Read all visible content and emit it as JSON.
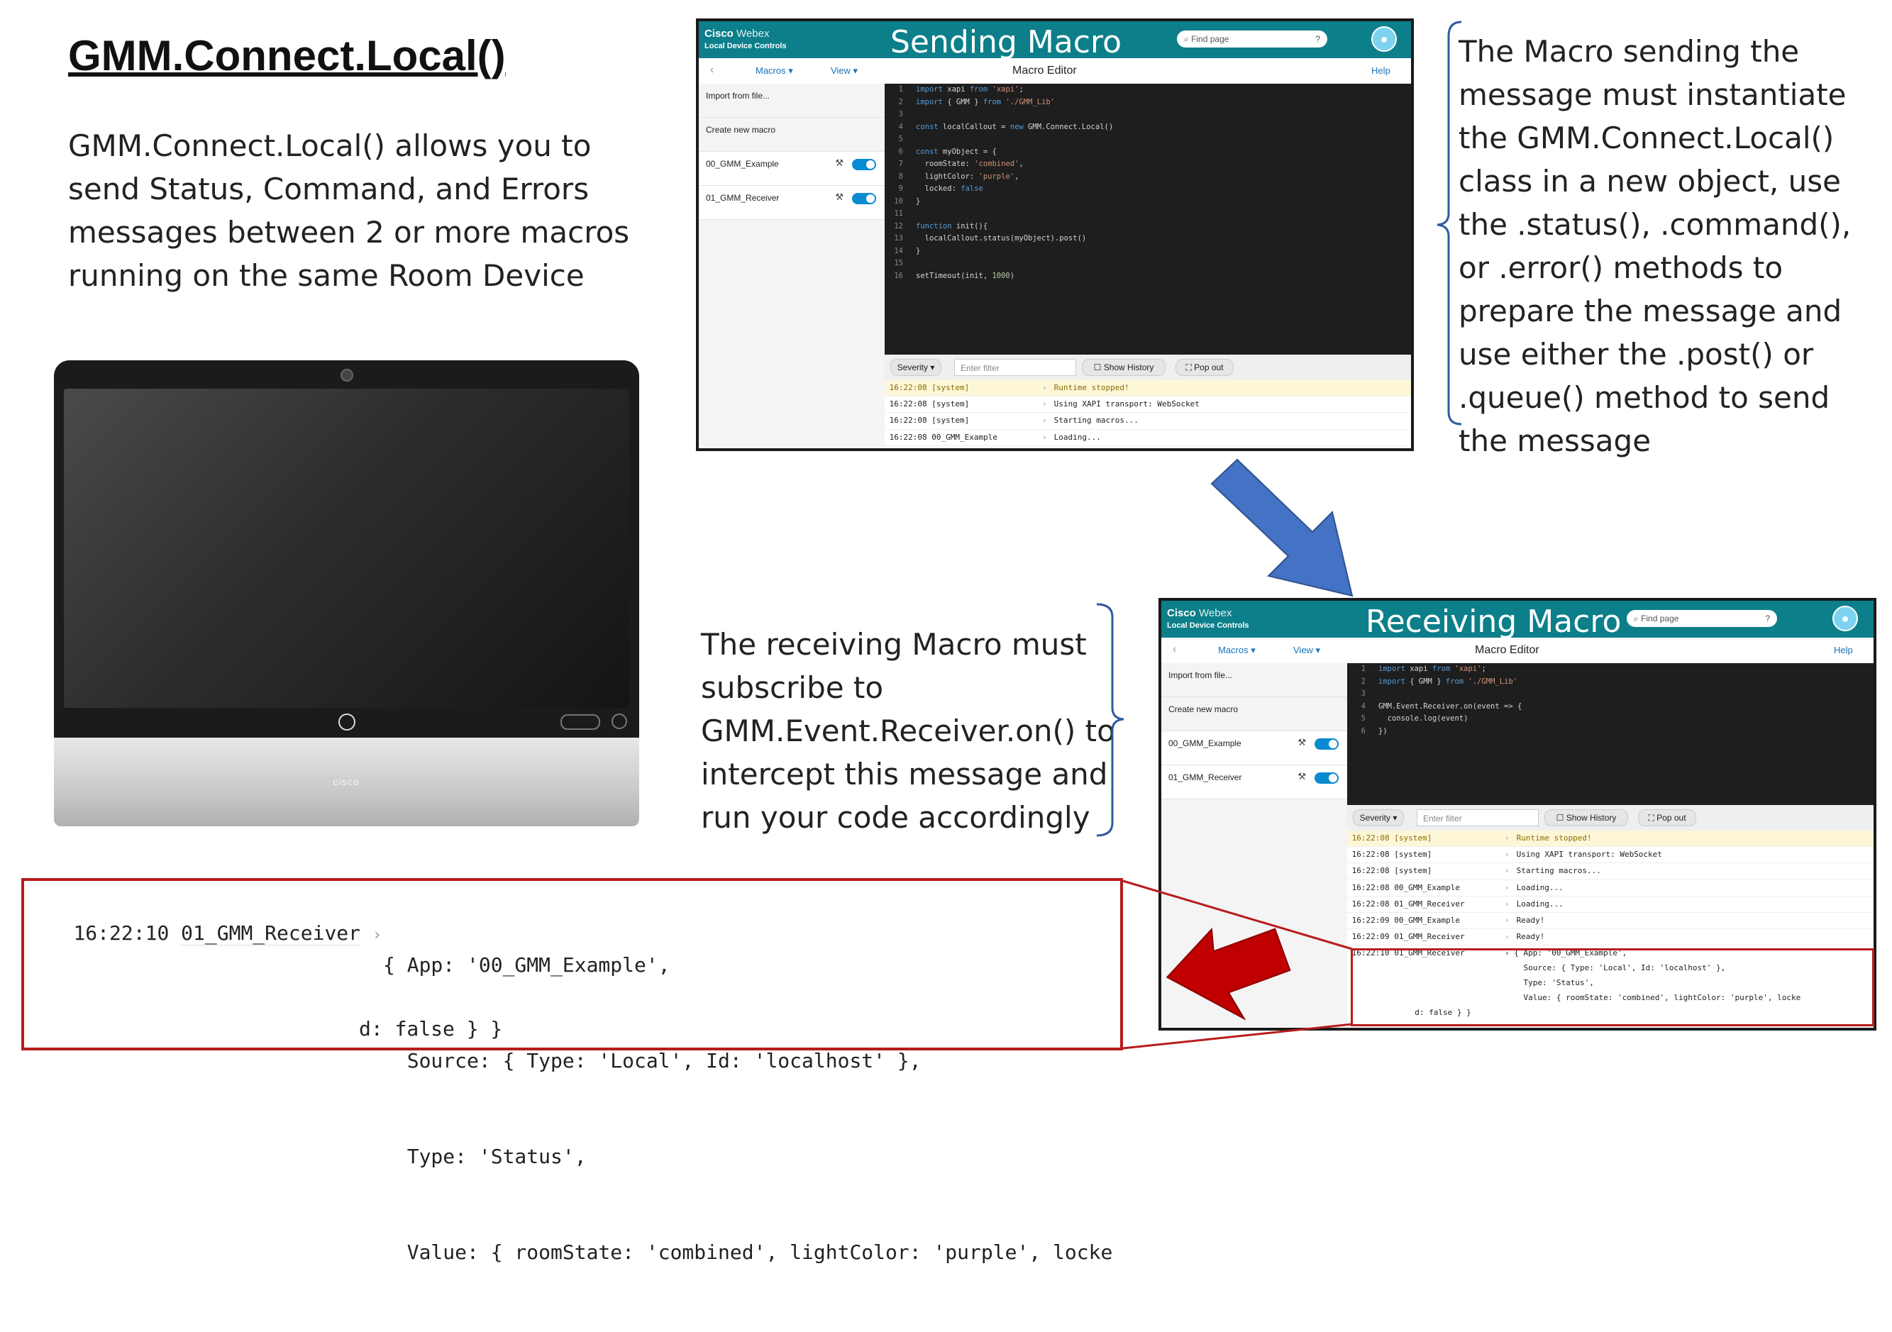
{
  "slide": {
    "title": "GMM.Connect.Local()",
    "intro": "GMM.Connect.Local() allows you to send Status, Command, and Errors messages between 2 or more macros running on the same Room Device",
    "sender_desc": "The Macro sending the message must instantiate the GMM.Connect.Local() class in a new object, use the .status(), .command(), or .error() methods to prepare the message and use either the .post() or .queue() method to send the message",
    "receiver_desc": "The receiving Macro must subscribe to GMM.Event.Receiver.on() to intercept this message and run your code accordingly"
  },
  "device": {
    "logo": "cisco"
  },
  "common": {
    "brand_cisco": "Cisco",
    "brand_webex": "Webex",
    "brand_sub": "Local Device Controls",
    "find_placeholder": "Find page",
    "back": "‹",
    "macros_menu": "Macros ▾",
    "view_menu": "View ▾",
    "editor_title": "Macro Editor",
    "help": "Help",
    "sidebar": [
      "Import from file...",
      "Create new macro"
    ],
    "macros": [
      "00_GMM_Example",
      "01_GMM_Receiver"
    ],
    "severity": "Severity ▾",
    "filter_placeholder": "Enter filter",
    "show_history": "Show History",
    "pop_out": "Pop out"
  },
  "sending": {
    "title": "Sending Macro",
    "code": [
      "import xapi from 'xapi';",
      "import { GMM } from './GMM_Lib'",
      "",
      "const localCallout = new GMM.Connect.Local()",
      "",
      "const myObject = {",
      "  roomState: 'combined',",
      "  lightColor: 'purple',",
      "  locked: false",
      "}",
      "",
      "function init(){",
      "  localCallout.status(myObject).post()",
      "}",
      "",
      "setTimeout(init, 1000)"
    ],
    "log": [
      {
        "time": "16:22:08",
        "src": "[system]",
        "msg": "Runtime stopped!",
        "warn": true
      },
      {
        "time": "16:22:08",
        "src": "[system]",
        "msg": "Using XAPI transport: WebSocket",
        "warn": false
      },
      {
        "time": "16:22:08",
        "src": "[system]",
        "msg": "Starting macros...",
        "warn": false
      },
      {
        "time": "16:22:08",
        "src": "00_GMM_Example",
        "msg": "Loading...",
        "warn": false
      }
    ]
  },
  "receiving": {
    "title": "Receiving Macro",
    "code": [
      "import xapi from 'xapi';",
      "import { GMM } from './GMM_Lib'",
      "",
      "GMM.Event.Receiver.on(event => {",
      "  console.log(event)",
      "})"
    ],
    "log": [
      {
        "time": "16:22:08",
        "src": "[system]",
        "msg": "Runtime stopped!",
        "warn": true
      },
      {
        "time": "16:22:08",
        "src": "[system]",
        "msg": "Using XAPI transport: WebSocket",
        "warn": false
      },
      {
        "time": "16:22:08",
        "src": "[system]",
        "msg": "Starting macros...",
        "warn": false
      },
      {
        "time": "16:22:08",
        "src": "00_GMM_Example",
        "msg": "Loading...",
        "warn": false
      },
      {
        "time": "16:22:08",
        "src": "01_GMM_Receiver",
        "msg": "Loading...",
        "warn": false
      },
      {
        "time": "16:22:09",
        "src": "00_GMM_Example",
        "msg": "Ready!",
        "warn": false
      },
      {
        "time": "16:22:09",
        "src": "01_GMM_Receiver",
        "msg": "Ready!",
        "warn": false
      }
    ],
    "last_entry": {
      "time": "16:22:10",
      "src": "01_GMM_Receiver",
      "lines": [
        "{ App: '00_GMM_Example',",
        "  Source: { Type: 'Local', Id: 'localhost' },",
        "  Type: 'Status',",
        "  Value: { roomState: 'combined', lightColor: 'purple', locke",
        "d: false } }"
      ]
    }
  },
  "zoomed_log": {
    "time": "16:22:10",
    "src": "01_GMM_Receiver",
    "arrow": "›",
    "lines": [
      "{ App: '00_GMM_Example',",
      "  Source: { Type: 'Local', Id: 'localhost' },",
      "  Type: 'Status',",
      "  Value: { roomState: 'combined', lightColor: 'purple', locke",
      "d: false } }"
    ]
  },
  "colors": {
    "header_teal": "#0c7f8a",
    "arrow_blue": "#4472c4",
    "arrow_red": "#c00000",
    "bracket_blue": "#2e5c9e"
  }
}
